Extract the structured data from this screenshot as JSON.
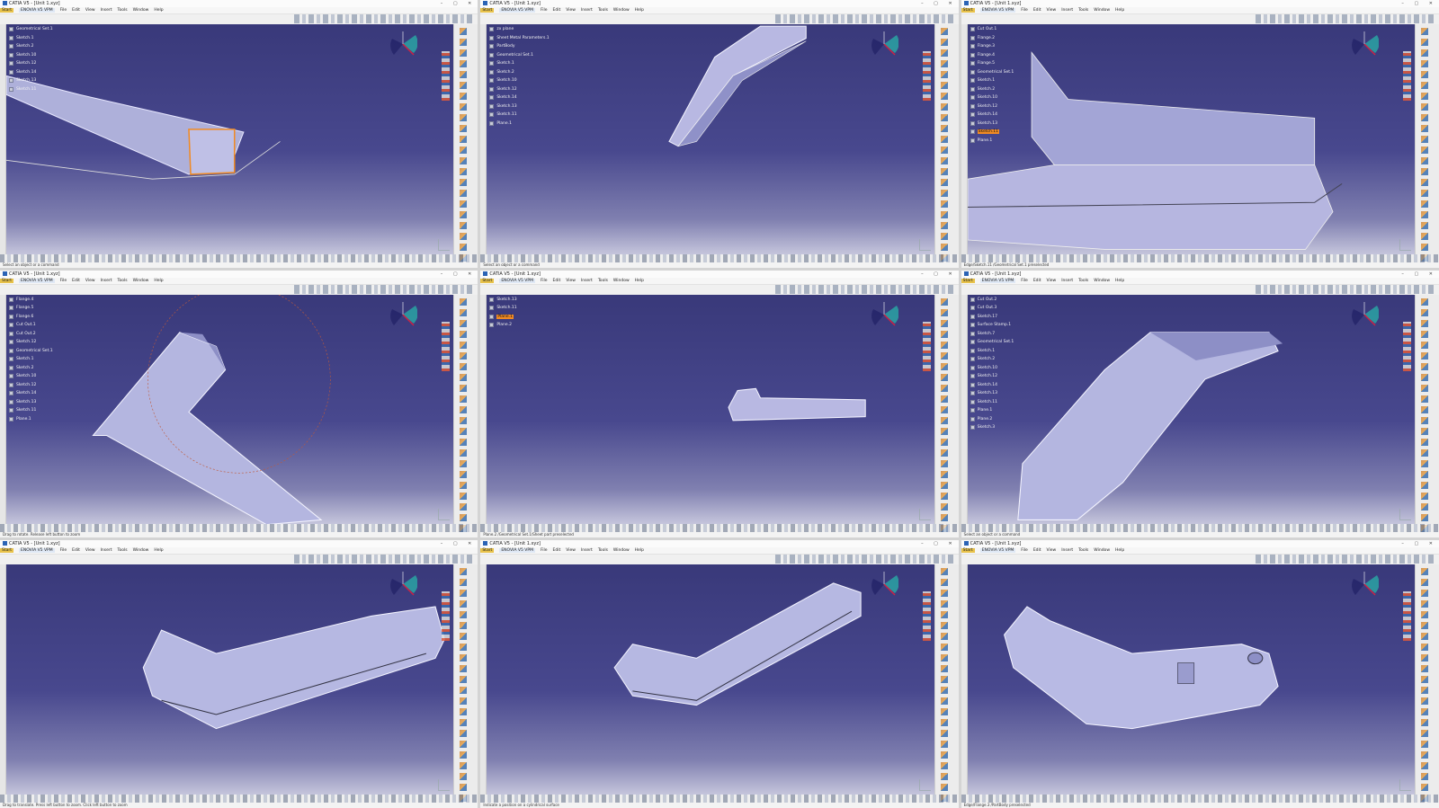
{
  "app": {
    "title": "CATIA V5 - [Unit 1.xyz]",
    "menu": [
      "Start",
      "ENOVIA V5 VPM",
      "File",
      "Edit",
      "View",
      "Insert",
      "Tools",
      "Window",
      "Help"
    ],
    "window_buttons": "– ▢ ✕"
  },
  "colors": {
    "viewport_top": "#39397a",
    "viewport_bottom": "#c5c5dc",
    "part_fill": "#b8b8e0",
    "highlight": "#f08a24",
    "compass_blue": "#2aa3a3",
    "compass_red": "#cc2244"
  },
  "panes": [
    {
      "id": "top-left",
      "tree": [
        "Geometrical Set.1",
        "Sketch.1",
        "Sketch.2",
        "Sketch.10",
        "Sketch.12",
        "Sketch.14",
        "Sketch.13",
        "Sketch.11"
      ],
      "status": "Select an object or a command"
    },
    {
      "id": "top-center",
      "tree": [
        "zx plane",
        "Sheet Metal Parameters.1",
        "PartBody",
        "Geometrical Set.1",
        "Sketch.1",
        "Sketch.2",
        "Sketch.10",
        "Sketch.12",
        "Sketch.14",
        "Sketch.13",
        "Sketch.11",
        "Plane.1"
      ],
      "status": "Select an object or a command"
    },
    {
      "id": "top-right",
      "tree": [
        "Cut Out.1",
        "Flange.2",
        "Flange.3",
        "Flange.4",
        "Flange.5",
        "Geometrical Set.1",
        "Sketch.1",
        "Sketch.2",
        "Sketch.10",
        "Sketch.12",
        "Sketch.14",
        "Sketch.13",
        "Sketch.11",
        "Plane.1"
      ],
      "status": "Edge/Sketch.11 /Geometrical Set.1 preselected"
    },
    {
      "id": "middle-left",
      "tree": [
        "Flange.4",
        "Flange.5",
        "Flange.6",
        "Cut Out.1",
        "Cut Out.2",
        "Sketch.12",
        "Geometrical Set.1",
        "Sketch.1",
        "Sketch.2",
        "Sketch.10",
        "Sketch.12",
        "Sketch.14",
        "Sketch.13",
        "Sketch.11",
        "Plane.1"
      ],
      "status": "Drag to rotate. Release left button to zoom"
    },
    {
      "id": "middle-center",
      "tree": [
        "Sketch.13",
        "Sketch.11",
        "Plane.1",
        "Plane.2"
      ],
      "status": "Plane.2 /Geometrical Set.1/Sheet part preselected"
    },
    {
      "id": "middle-right",
      "tree": [
        "Cut Out.2",
        "Cut Out.3",
        "Sketch.17",
        "Surface Stamp.1",
        "Sketch.7",
        "Geometrical Set.1",
        "Sketch.1",
        "Sketch.2",
        "Sketch.10",
        "Sketch.12",
        "Sketch.14",
        "Sketch.13",
        "Sketch.11",
        "Plane.1",
        "Plane.2",
        "Sketch.3"
      ],
      "status": "Select an object or a command"
    },
    {
      "id": "bottom-left",
      "tree": [],
      "status": "Drag to translate. Press left button to zoom. Click left button to zoom"
    },
    {
      "id": "bottom-center",
      "tree": [],
      "status": "Indicate a position on a cylindrical surface"
    },
    {
      "id": "bottom-right",
      "tree": [],
      "status": "Edge/Flange.3 /PartBody preselected"
    }
  ]
}
